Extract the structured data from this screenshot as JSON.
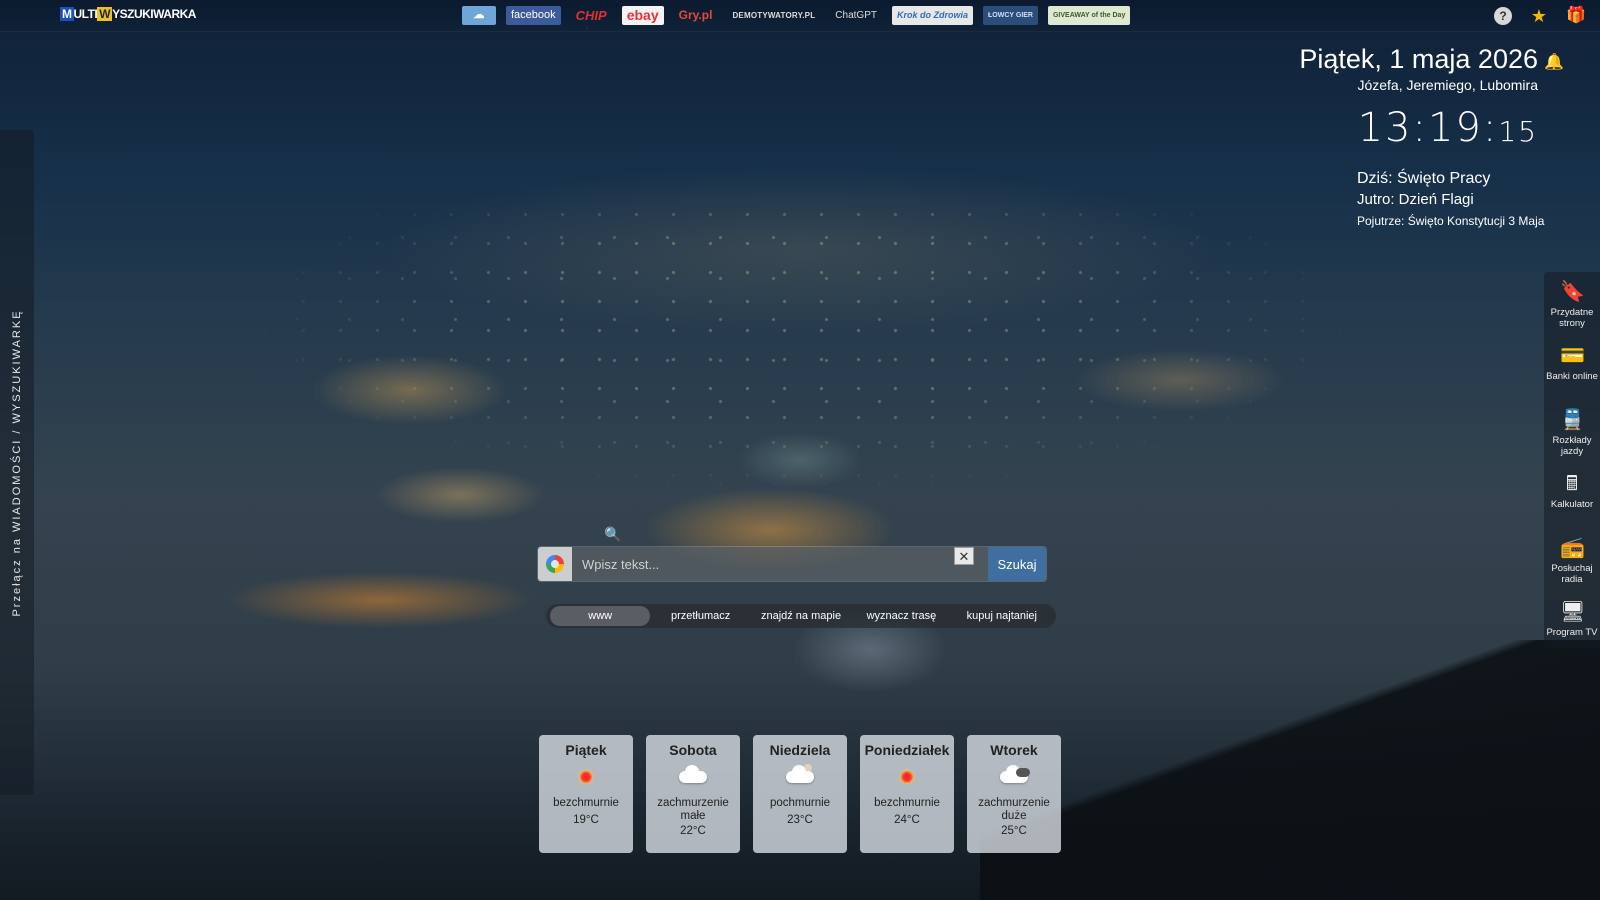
{
  "app": {
    "logo_text": "MULTIWYSZUKIWARKA",
    "logo_m": "M",
    "logo_w": "W"
  },
  "shortcuts": [
    {
      "name": "cloud-icon",
      "label": "☁"
    },
    {
      "name": "facebook",
      "label": "facebook"
    },
    {
      "name": "chip",
      "label": "CHIP"
    },
    {
      "name": "ebay",
      "label": "ebay"
    },
    {
      "name": "gry",
      "label": "Gry.pl"
    },
    {
      "name": "demotywatory",
      "label": "DEMOTYWATORY.PL"
    },
    {
      "name": "chatgpt",
      "label": "ChatGPT"
    },
    {
      "name": "krok",
      "label": "Krok do Zdrowia"
    },
    {
      "name": "lowcy",
      "label": "ŁOWCY GIER"
    },
    {
      "name": "giveaway",
      "label": "GIVEAWAY of the Day"
    }
  ],
  "top_icons": {
    "help": "?",
    "star": "★",
    "gift": "🎁"
  },
  "left_toggle": {
    "label": "Przełącz na  WIADOMOŚCI / WYSZUKIWARKĘ"
  },
  "datetime": {
    "date": "Piątek, 1 maja 2026",
    "namedays": "Józefa, Jeremiego, Lubomira",
    "time": "13:19:",
    "seconds": "15"
  },
  "holidays": {
    "today": "Dziś: Święto Pracy",
    "tomorrow": "Jutro: Dzień Flagi",
    "after": "Pojutrze: Święto Konstytucji 3 Maja"
  },
  "right_bar": [
    {
      "icon": "bookmark-icon",
      "glyph": "🔖",
      "label": "Przydatne strony"
    },
    {
      "icon": "card-icon",
      "glyph": "💳",
      "label": "Banki online"
    },
    {
      "icon": "train-icon",
      "glyph": "🚆",
      "label": "Rozkłady jazdy"
    },
    {
      "icon": "calculator-icon",
      "glyph": "🖩",
      "label": "Kalkulator"
    },
    {
      "icon": "radio-icon",
      "glyph": "📻",
      "label": "Posłuchaj radia"
    },
    {
      "icon": "tv-icon",
      "glyph": "🖥",
      "label": "Program TV"
    }
  ],
  "search": {
    "placeholder": "Wpisz tekst...",
    "clear": "✕",
    "button": "Szukaj",
    "tabs": [
      "www",
      "przetłumacz",
      "znajdź na mapie",
      "wyznacz trasę",
      "kupuj najtaniej"
    ],
    "active_tab": "www"
  },
  "weather": [
    {
      "day": "Piątek",
      "icon": "sun",
      "desc": "bezchmurnie",
      "temp": "19°C"
    },
    {
      "day": "Sobota",
      "icon": "cloud",
      "desc": "zachmurzenie małe",
      "temp": "22°C"
    },
    {
      "day": "Niedziela",
      "icon": "cloud-sun",
      "desc": "pochmurnie",
      "temp": "23°C"
    },
    {
      "day": "Poniedziałek",
      "icon": "sun",
      "desc": "bezchmurnie",
      "temp": "24°C"
    },
    {
      "day": "Wtorek",
      "icon": "cloud-dark",
      "desc": "zachmurzenie duże",
      "temp": "25°C"
    }
  ]
}
